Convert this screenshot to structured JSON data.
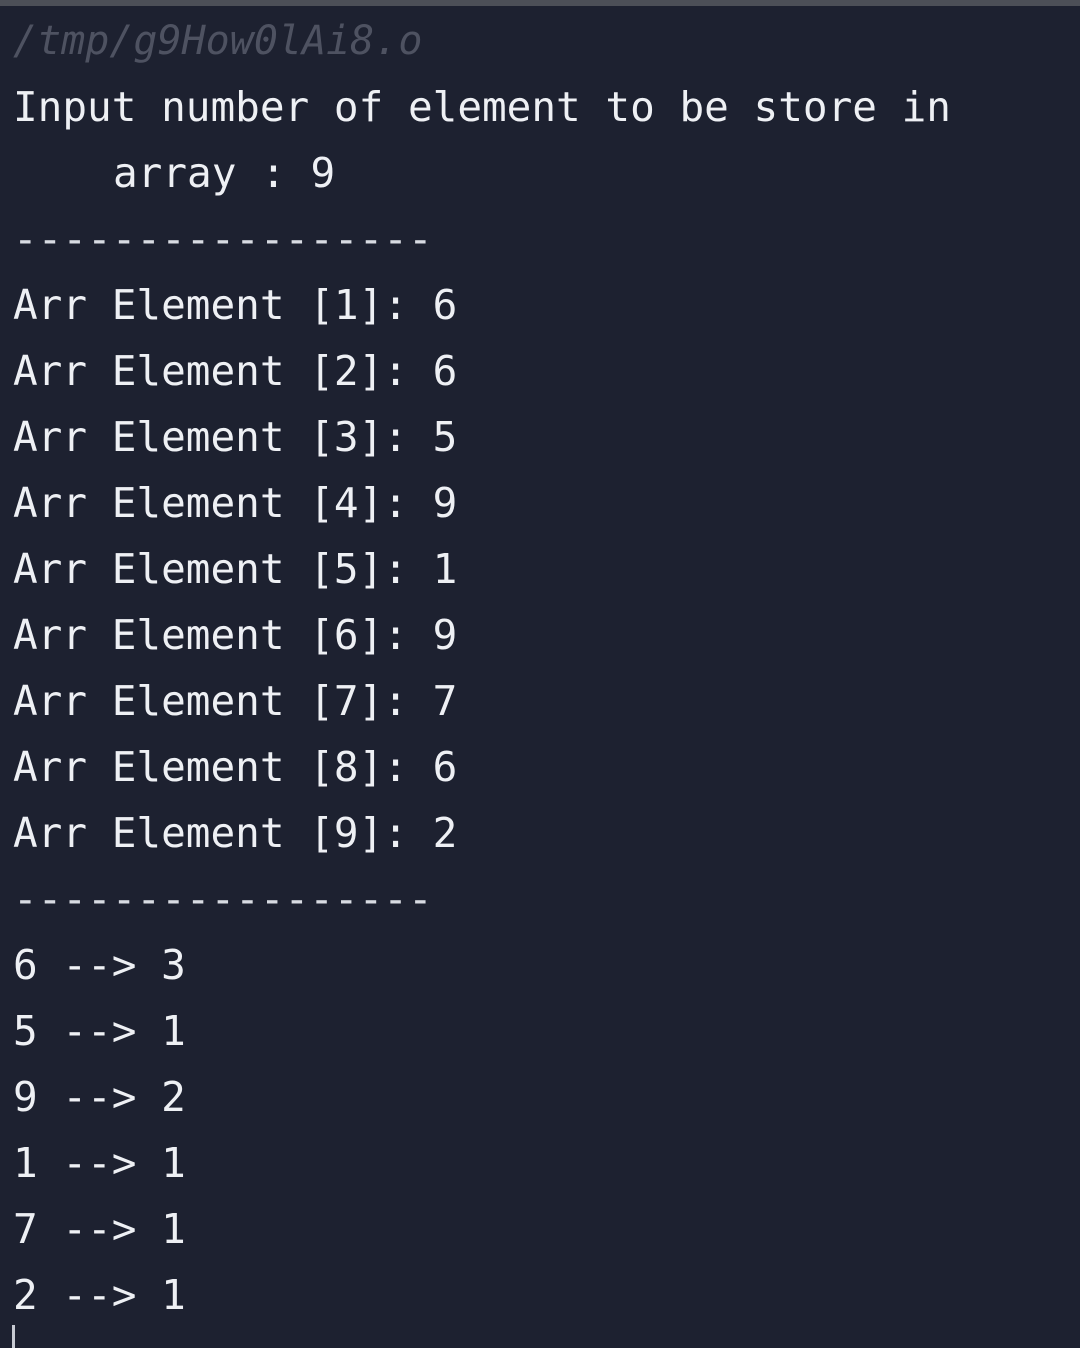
{
  "terminal": {
    "path": "/tmp/g9How0lAi8.o",
    "prompt_line1": "Input number of element to be store in",
    "prompt_line2": "array : 9",
    "separator": "-----------------",
    "elements": [
      "Arr Element [1]: 6",
      "Arr Element [2]: 6",
      "Arr Element [3]: 5",
      "Arr Element [4]: 9",
      "Arr Element [5]: 1",
      "Arr Element [6]: 9",
      "Arr Element [7]: 7",
      "Arr Element [8]: 6",
      "Arr Element [9]: 2"
    ],
    "frequencies": [
      "6 --> 3",
      "5 --> 1",
      "9 --> 2",
      "1 --> 1",
      "7 --> 1",
      "2 --> 1"
    ]
  },
  "colors": {
    "background": "#1d2130",
    "text": "#eef0f4",
    "path_text": "#4e5261"
  }
}
